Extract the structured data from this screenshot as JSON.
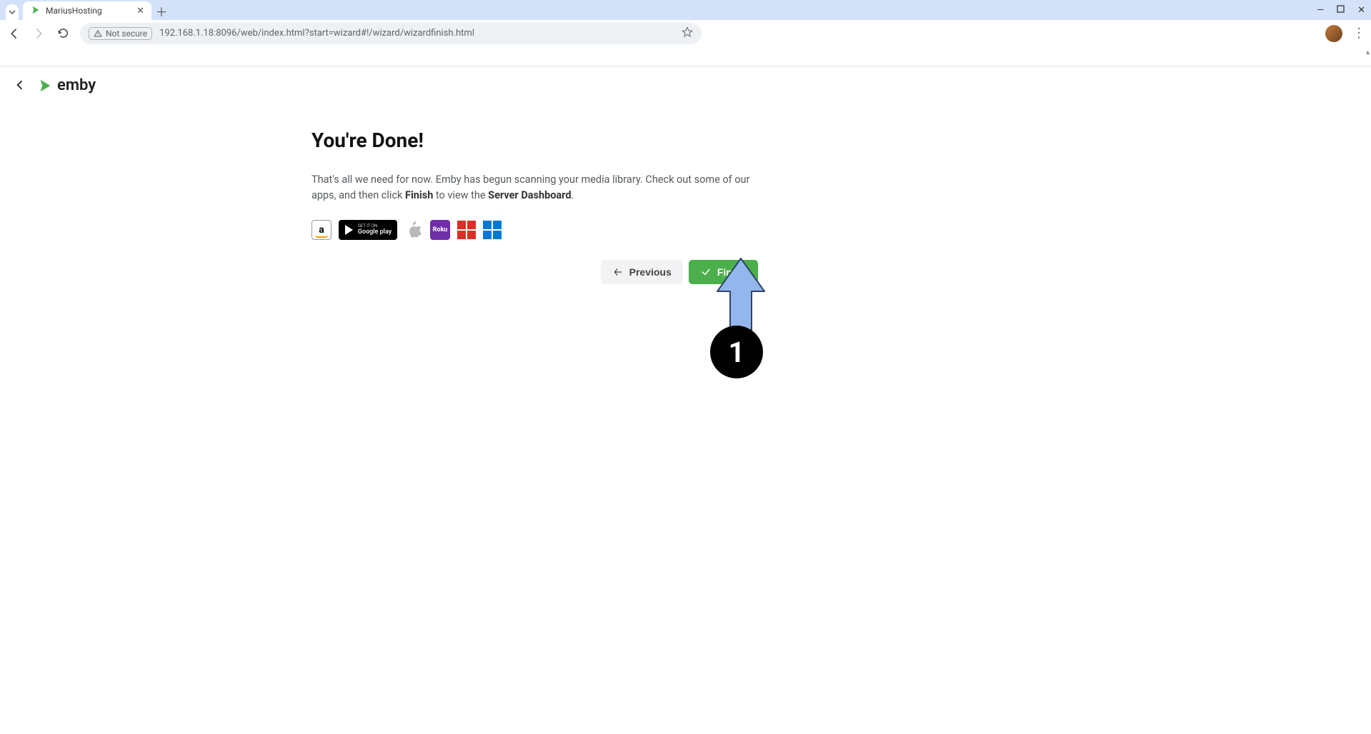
{
  "browser": {
    "tab_title": "MariusHosting",
    "url": "192.168.1.18:8096/web/index.html?start=wizard#!/wizard/wizardfinish.html",
    "not_secure_label": "Not secure"
  },
  "emby": {
    "brand": "emby"
  },
  "wizard": {
    "title": "You're Done!",
    "body_prefix": "That's all we need for now. Emby has begun scanning your media library. Check out some of our apps, and then click ",
    "body_strong1": "Finish",
    "body_mid": " to view the ",
    "body_strong2": "Server Dashboard",
    "body_suffix": ".",
    "apps": {
      "amazon": "a",
      "google_small": "GET IT ON",
      "google_big": "Google play",
      "roku": "Roku"
    },
    "buttons": {
      "previous": "Previous",
      "finish": "Finish"
    }
  },
  "annotation": {
    "step": "1"
  }
}
